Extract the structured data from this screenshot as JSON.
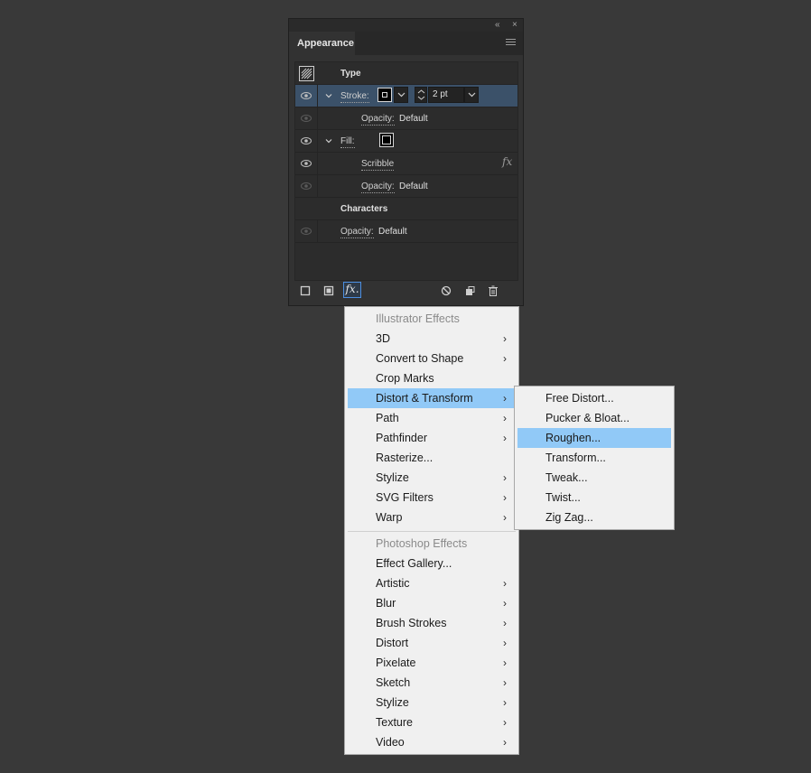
{
  "panel": {
    "tab_title": "Appearance",
    "object_type": "Type",
    "stroke": {
      "label": "Stroke:",
      "weight": "2 pt"
    },
    "stroke_opacity": {
      "label": "Opacity:",
      "value": "Default"
    },
    "fill": {
      "label": "Fill:"
    },
    "scribble": {
      "label": "Scribble",
      "fx": "fx"
    },
    "fill_opacity": {
      "label": "Opacity:",
      "value": "Default"
    },
    "characters": "Characters",
    "opacity": {
      "label": "Opacity:",
      "value": "Default"
    },
    "fx_button": "fx."
  },
  "effects_menu": {
    "illustrator_header": "Illustrator Effects",
    "illustrator_items": [
      "3D",
      "Convert to Shape",
      "Crop Marks",
      "Distort & Transform",
      "Path",
      "Pathfinder",
      "Rasterize...",
      "Stylize",
      "SVG Filters",
      "Warp"
    ],
    "photoshop_header": "Photoshop Effects",
    "photoshop_items": [
      "Effect Gallery...",
      "Artistic",
      "Blur",
      "Brush Strokes",
      "Distort",
      "Pixelate",
      "Sketch",
      "Stylize",
      "Texture",
      "Video"
    ],
    "highlighted": "Distort & Transform"
  },
  "submenu": {
    "items": [
      "Free Distort...",
      "Pucker & Bloat...",
      "Roughen...",
      "Transform...",
      "Tweak...",
      "Twist...",
      "Zig Zag..."
    ],
    "highlighted": "Roughen..."
  },
  "colors": {
    "panel_bg": "#323232",
    "selected_row": "#3b5169",
    "menu_highlight": "#91c9f7"
  }
}
